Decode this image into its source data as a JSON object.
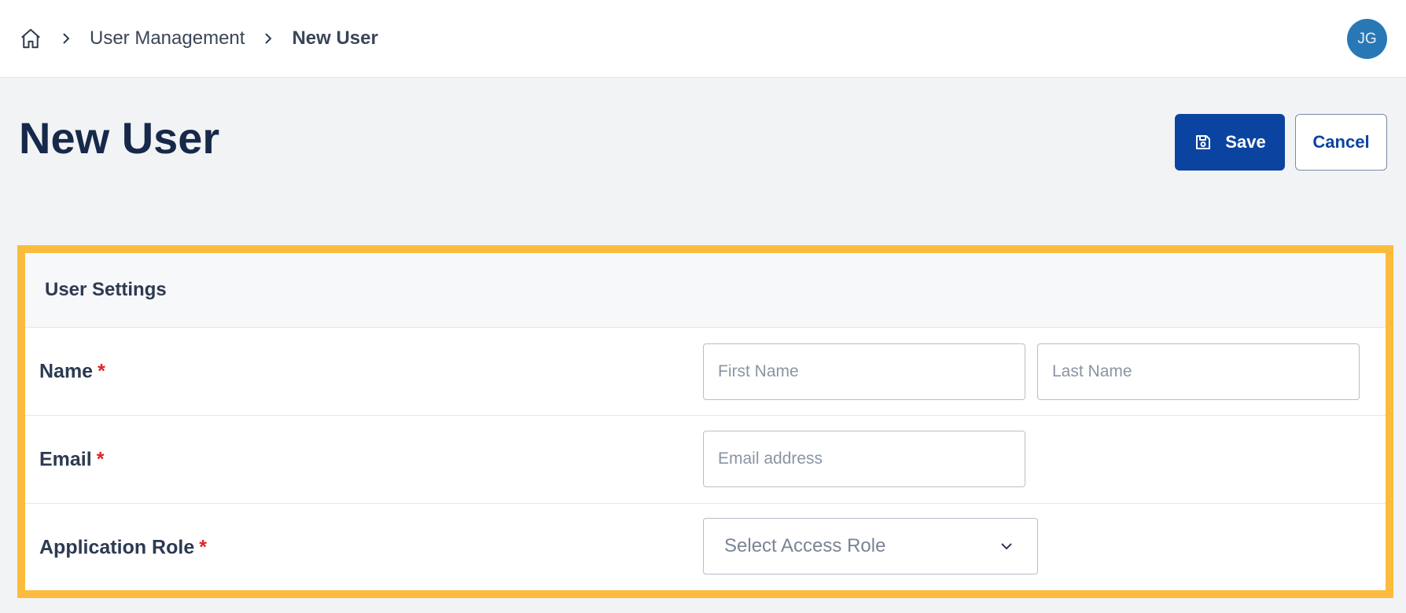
{
  "breadcrumb": {
    "items": [
      {
        "label": "User Management"
      },
      {
        "label": "New User"
      }
    ]
  },
  "user": {
    "initials": "JG"
  },
  "page": {
    "title": "New User"
  },
  "actions": {
    "save_label": "Save",
    "cancel_label": "Cancel"
  },
  "form": {
    "section_title": "User Settings",
    "name": {
      "label": "Name",
      "required_mark": "*",
      "first_placeholder": "First Name",
      "last_placeholder": "Last Name"
    },
    "email": {
      "label": "Email",
      "required_mark": "*",
      "placeholder": "Email address"
    },
    "role": {
      "label": "Application Role",
      "required_mark": "*",
      "placeholder": "Select Access Role"
    }
  },
  "colors": {
    "primary": "#0b44a0",
    "avatar": "#2878b5",
    "highlight": "#fbbc3d",
    "required": "#e02424"
  }
}
